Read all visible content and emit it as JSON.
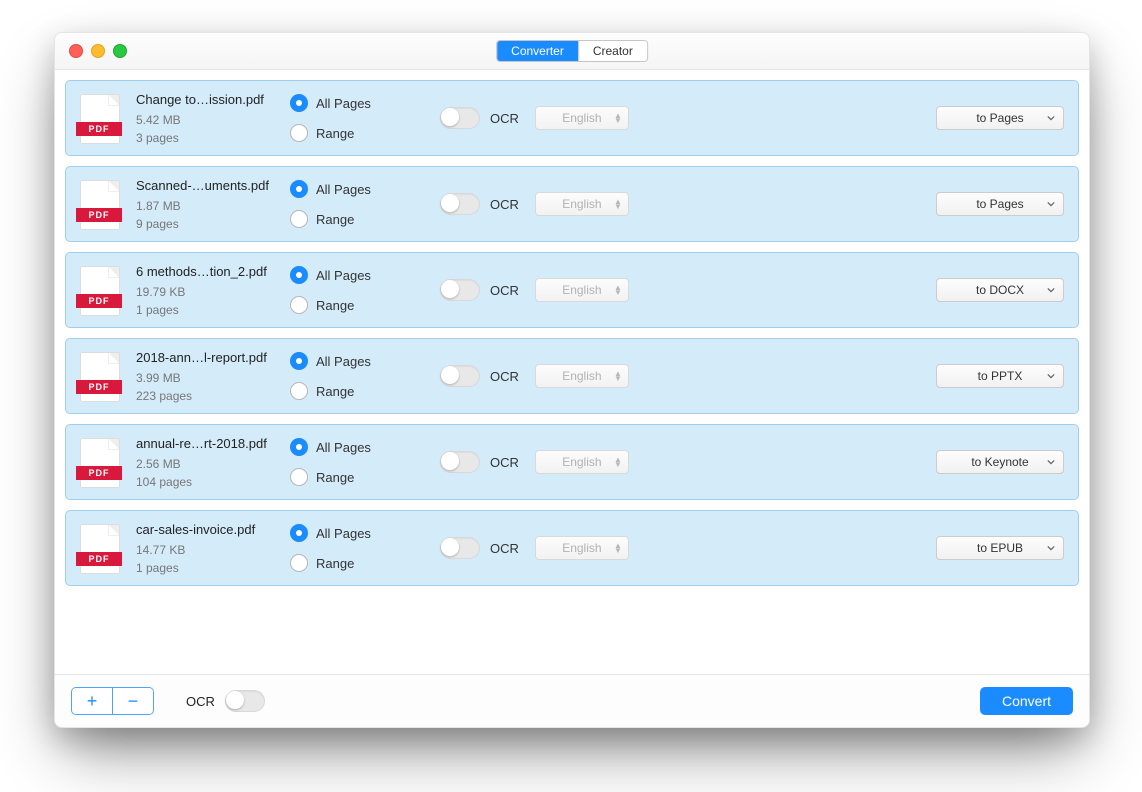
{
  "header": {
    "tabs": [
      {
        "label": "Converter",
        "active": true
      },
      {
        "label": "Creator",
        "active": false
      }
    ]
  },
  "files": [
    {
      "name": "Change to…ission.pdf",
      "size": "5.42 MB",
      "pages": "3 pages",
      "page_option": "all",
      "ocr_on": false,
      "lang": "English",
      "format": "to Pages"
    },
    {
      "name": "Scanned-…uments.pdf",
      "size": "1.87 MB",
      "pages": "9 pages",
      "page_option": "all",
      "ocr_on": false,
      "lang": "English",
      "format": "to Pages"
    },
    {
      "name": "6 methods…tion_2.pdf",
      "size": "19.79 KB",
      "pages": "1 pages",
      "page_option": "all",
      "ocr_on": false,
      "lang": "English",
      "format": "to DOCX"
    },
    {
      "name": "2018-ann…l-report.pdf",
      "size": "3.99 MB",
      "pages": "223 pages",
      "page_option": "all",
      "ocr_on": false,
      "lang": "English",
      "format": "to PPTX"
    },
    {
      "name": "annual-re…rt-2018.pdf",
      "size": "2.56 MB",
      "pages": "104 pages",
      "page_option": "all",
      "ocr_on": false,
      "lang": "English",
      "format": "to Keynote"
    },
    {
      "name": "car-sales-invoice.pdf",
      "size": "14.77 KB",
      "pages": "1 pages",
      "page_option": "all",
      "ocr_on": false,
      "lang": "English",
      "format": "to EPUB"
    }
  ],
  "labels": {
    "all_pages": "All Pages",
    "range": "Range",
    "ocr": "OCR",
    "pdf_badge": "PDF"
  },
  "footer": {
    "add_label": "+",
    "remove_label": "−",
    "ocr_label": "OCR",
    "convert_label": "Convert"
  }
}
